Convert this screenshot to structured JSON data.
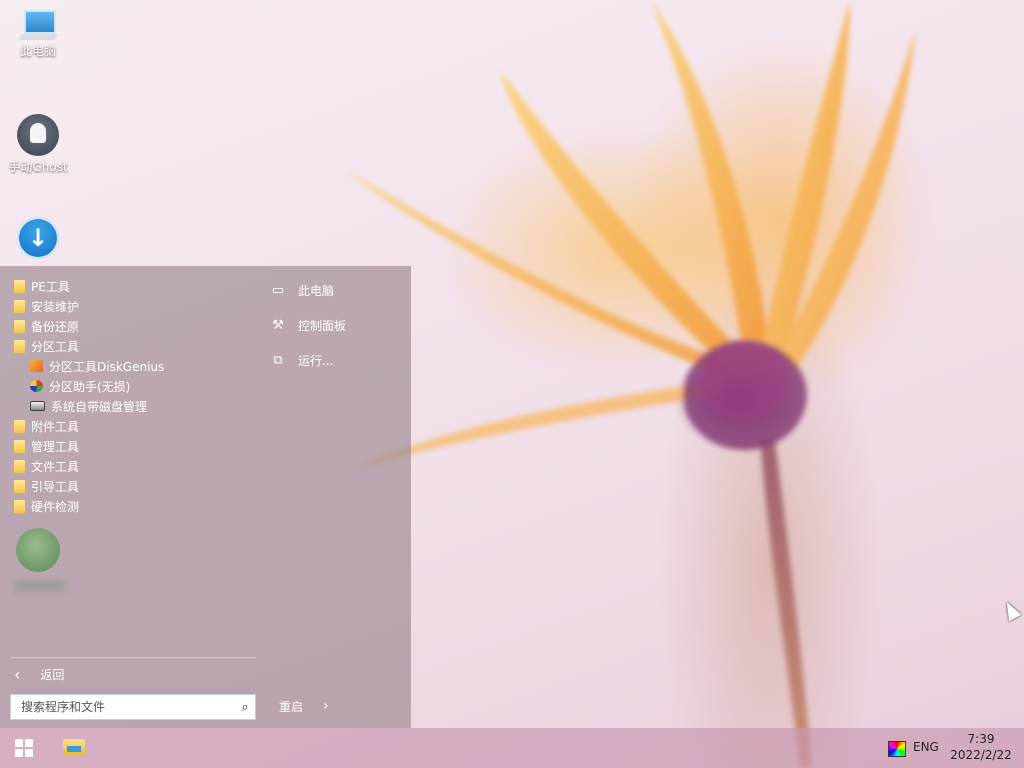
{
  "desktop": {
    "icons": [
      {
        "label": "此电脑",
        "icon": "computer-icon"
      },
      {
        "label": "手动Ghost",
        "icon": "ghost-icon"
      },
      {
        "label": "",
        "icon": "download-icon"
      }
    ]
  },
  "start_menu": {
    "tree": [
      {
        "label": "PE工具",
        "type": "folder"
      },
      {
        "label": "安装维护",
        "type": "folder"
      },
      {
        "label": "备份还原",
        "type": "folder"
      },
      {
        "label": "分区工具",
        "type": "folder"
      },
      {
        "label": "分区工具DiskGenius",
        "type": "app",
        "icon": "diskgenius-icon"
      },
      {
        "label": "分区助手(无损)",
        "type": "app",
        "icon": "partition-assistant-icon"
      },
      {
        "label": "系统自带磁盘管理",
        "type": "app",
        "icon": "disk-management-icon"
      },
      {
        "label": "附件工具",
        "type": "folder"
      },
      {
        "label": "管理工具",
        "type": "folder"
      },
      {
        "label": "文件工具",
        "type": "folder"
      },
      {
        "label": "引导工具",
        "type": "folder"
      },
      {
        "label": "硬件检测",
        "type": "folder"
      }
    ],
    "right_links": [
      {
        "label": "此电脑",
        "icon": "laptop-icon"
      },
      {
        "label": "控制面板",
        "icon": "wrench-icon"
      },
      {
        "label": "运行...",
        "icon": "run-icon"
      }
    ],
    "back_label": "返回",
    "search": {
      "placeholder": "搜索程序和文件"
    },
    "restart_label": "重启"
  },
  "taskbar": {
    "language": "ENG",
    "time": "7:39",
    "date": "2022/2/22"
  }
}
